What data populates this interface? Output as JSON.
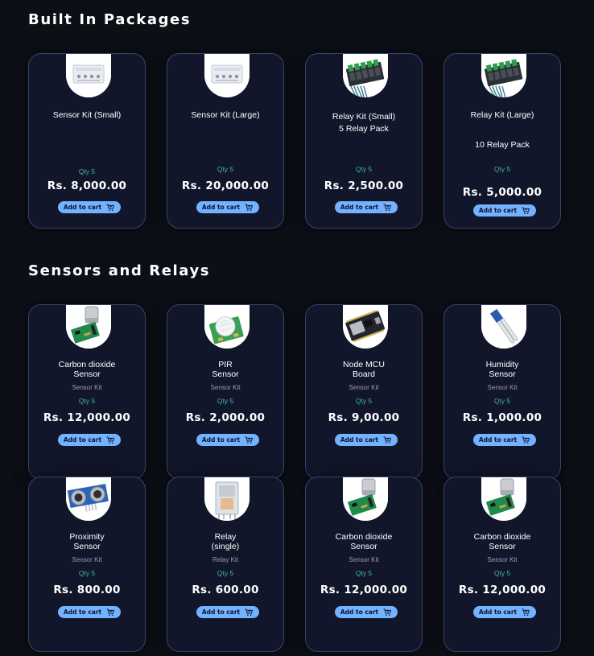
{
  "sections": [
    {
      "title": "Built In Packages",
      "cards": [
        {
          "name1": "Sensor Kit (Small)",
          "name2": "",
          "sub": "",
          "qty": "Qty 5",
          "price": "Rs. 8,000.00",
          "button": "Add to cart",
          "thumb": "sensor-kit"
        },
        {
          "name1": "Sensor Kit (Large)",
          "name2": "",
          "sub": "",
          "qty": "Qty 5",
          "price": "Rs. 20,000.00",
          "button": "Add to cart",
          "thumb": "sensor-kit"
        },
        {
          "name1": "Relay Kit (Small)",
          "name2": "5 Relay Pack",
          "sub": "",
          "qty": "Qty 5",
          "price": "Rs. 2,500.00",
          "button": "Add to cart",
          "thumb": "relay-board"
        },
        {
          "name1": "Relay Kit (Large)",
          "name2": "10 Relay Pack",
          "sub": "",
          "qty": "Qty 5",
          "price": "Rs. 5,000.00",
          "button": "Add to cart",
          "thumb": "relay-board"
        }
      ]
    },
    {
      "title": "Sensors and Relays",
      "cards": [
        {
          "name1": "Carbon dioxide",
          "name2": "Sensor",
          "sub": "Sensor Kit",
          "qty": "Qty 5",
          "price": "Rs. 12,000.00",
          "button": "Add to cart",
          "thumb": "co2-sensor"
        },
        {
          "name1": "PIR",
          "name2": "Sensor",
          "sub": "Sensor Kit",
          "qty": "Qty 5",
          "price": "Rs. 2,000.00",
          "button": "Add to cart",
          "thumb": "pir-sensor"
        },
        {
          "name1": "Node MCU",
          "name2": "Board",
          "sub": "Sensor Kit",
          "qty": "Qty 5",
          "price": "Rs. 9,00.00",
          "button": "Add to cart",
          "thumb": "nodemcu"
        },
        {
          "name1": "Humidity",
          "name2": "Sensor",
          "sub": "Sensor Kit",
          "qty": "Qty 5",
          "price": "Rs. 1,000.00",
          "button": "Add to cart",
          "thumb": "humidity-sensor"
        },
        {
          "name1": "Proximity",
          "name2": "Sensor",
          "sub": "Sensor Kit",
          "qty": "Qty 5",
          "price": "Rs. 800.00",
          "button": "Add to cart",
          "thumb": "ultrasonic-sensor"
        },
        {
          "name1": "Relay",
          "name2": "(single)",
          "sub": "Relay Kit",
          "qty": "Qty 5",
          "price": "Rs. 600.00",
          "button": "Add to cart",
          "thumb": "relay-single"
        },
        {
          "name1": "Carbon dioxide",
          "name2": "Sensor",
          "sub": "Sensor Kit",
          "qty": "Qty 5",
          "price": "Rs. 12,000.00",
          "button": "Add to cart",
          "thumb": "co2-sensor"
        },
        {
          "name1": "Carbon dioxide",
          "name2": "Sensor",
          "sub": "Sensor Kit",
          "qty": "Qty 5",
          "price": "Rs. 12,000.00",
          "button": "Add to cart",
          "thumb": "co2-sensor"
        }
      ]
    }
  ]
}
